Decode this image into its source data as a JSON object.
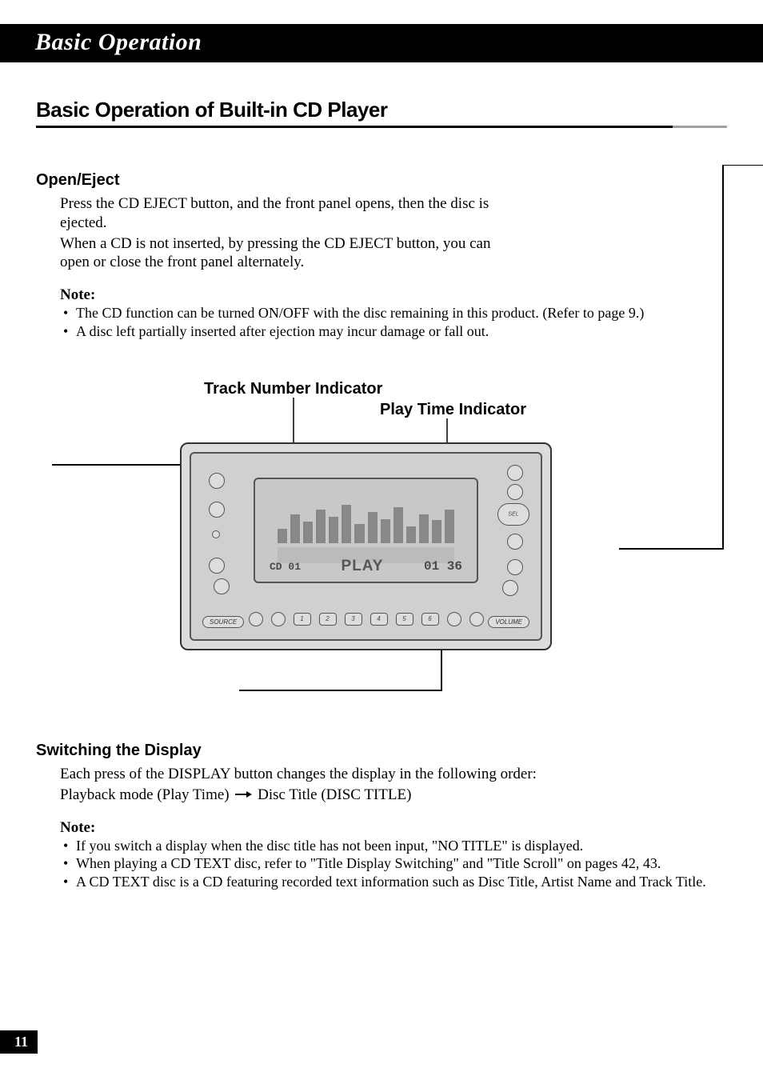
{
  "chapter": "Basic Operation",
  "section_title": "Basic Operation of Built-in CD Player",
  "open_eject": {
    "heading": "Open/Eject",
    "para1": "Press the CD EJECT button, and the front panel opens, then the disc is ejected.",
    "para2": "When a CD is not inserted, by pressing the CD EJECT button, you can open or close the front panel alternately.",
    "note_label": "Note:",
    "notes": [
      "The CD function can be turned ON/OFF with the disc remaining in this product. (Refer to page 9.)",
      "A disc left partially inserted after ejection may incur damage or fall out."
    ]
  },
  "callouts": {
    "track": "Track Number Indicator",
    "time": "Play Time Indicator"
  },
  "device": {
    "source_label": "SOURCE",
    "volume_label": "VOLUME",
    "sel_label": "SEL",
    "lcd_cd": "CD 01",
    "lcd_play": "PLAY",
    "lcd_time": "01 36",
    "preset_buttons": [
      "1",
      "2",
      "3",
      "4",
      "5",
      "6"
    ]
  },
  "switching": {
    "heading": "Switching the Display",
    "para1": "Each press of the DISPLAY button changes the display in the following order:",
    "mode_a": "Playback mode (Play Time)",
    "mode_b": "Disc Title (DISC TITLE)",
    "note_label": "Note:",
    "notes": [
      "If you switch a display when the disc title has not been input, \"NO TITLE\" is displayed.",
      "When playing a CD TEXT disc, refer to \"Title Display Switching\" and \"Title Scroll\" on pages 42, 43.",
      "A CD TEXT disc is a CD featuring recorded text information such as Disc Title, Artist Name and Track Title."
    ]
  },
  "page_number": "11"
}
